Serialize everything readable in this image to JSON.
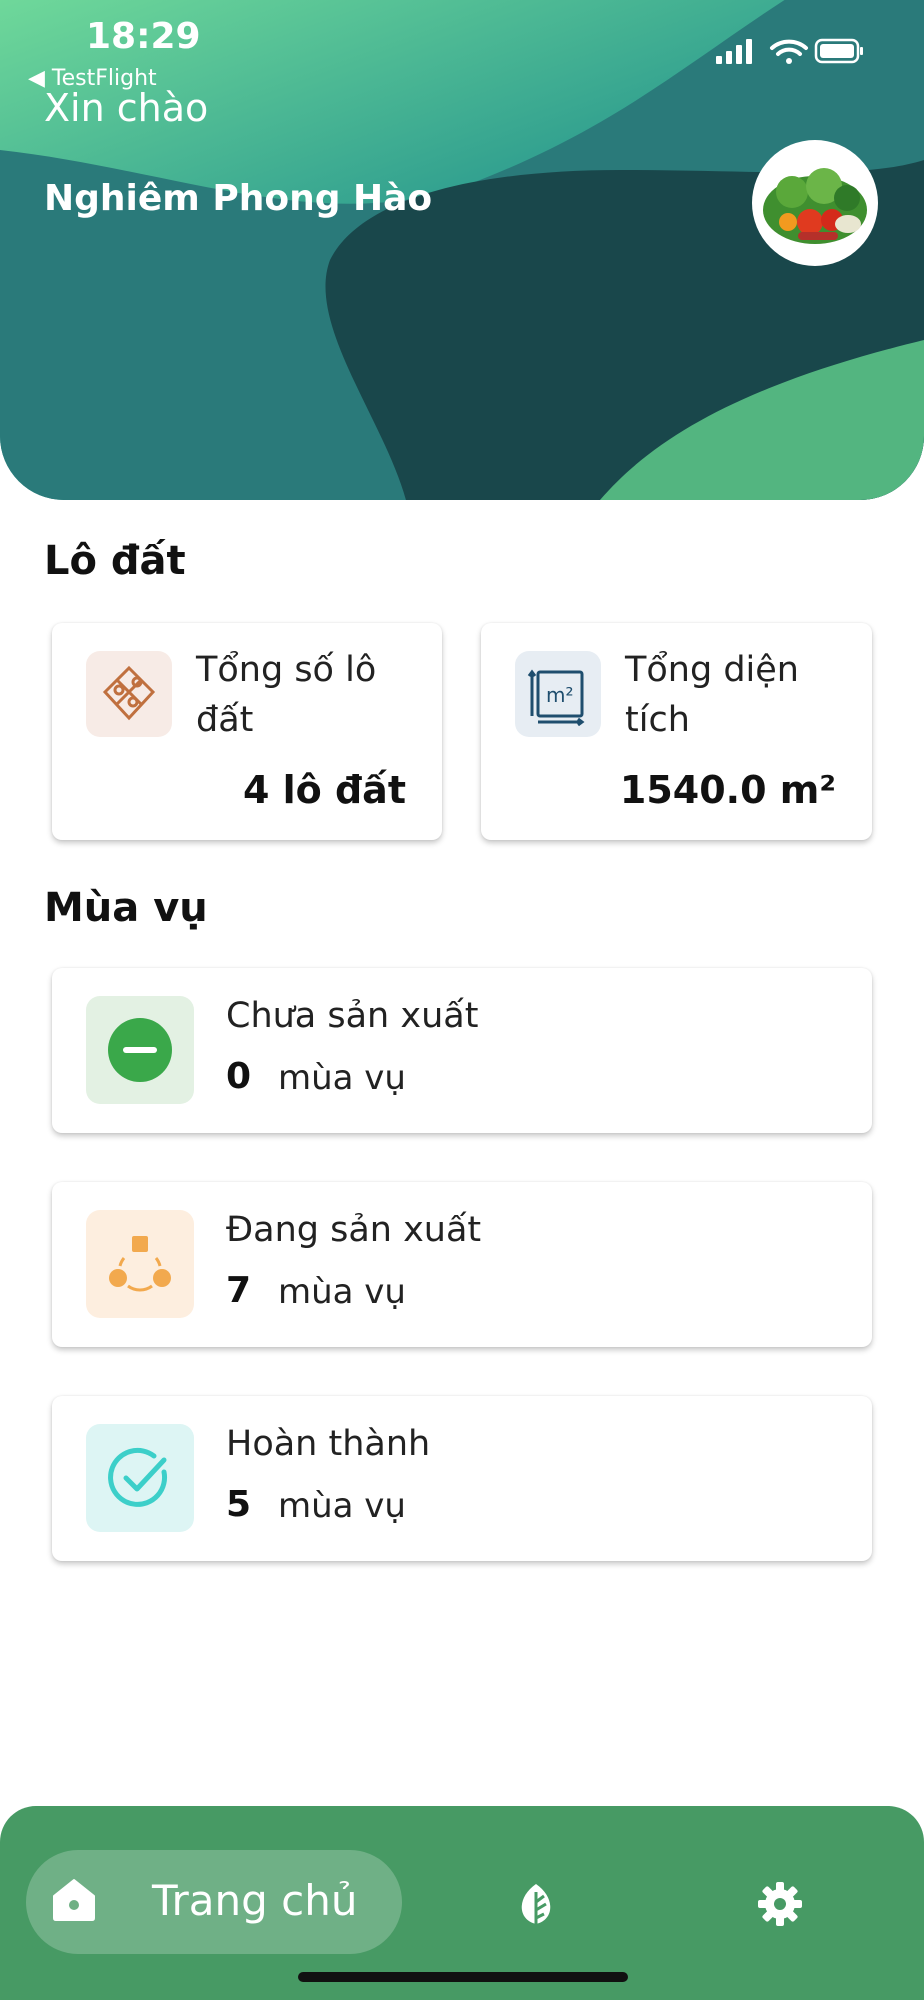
{
  "status_bar": {
    "time": "18:29",
    "back_app": "TestFlight"
  },
  "header": {
    "greeting": "Xin chào",
    "user_name": "Nghiêm Phong Hào",
    "avatar_icon": "vegetables-avatar"
  },
  "plots_section": {
    "title": "Lô đất",
    "cards": [
      {
        "label": "Tổng số lô đất",
        "value": "4 lô đất",
        "icon": "map-plot-icon",
        "icon_bg": "#f7ebe6"
      },
      {
        "label": "Tổng diện tích",
        "value": "1540.0 m²",
        "icon": "area-m2-icon",
        "icon_bg": "#e7edf3"
      }
    ]
  },
  "seasons_section": {
    "title": "Mùa vụ",
    "items": [
      {
        "label": "Chưa sản xuất",
        "count": "0",
        "unit": "mùa vụ",
        "icon": "minus-circle-icon",
        "icon_bg": "#e3f1e3"
      },
      {
        "label": "Đang sản xuất",
        "count": "7",
        "unit": "mùa vụ",
        "icon": "in-progress-icon",
        "icon_bg": "#fdeedf"
      },
      {
        "label": "Hoàn thành",
        "count": "5",
        "unit": "mùa vụ",
        "icon": "check-circle-icon",
        "icon_bg": "#ddf5f4"
      }
    ]
  },
  "bottom_nav": {
    "home_label": "Trang chủ",
    "items": [
      "home-icon",
      "leaf-icon",
      "gear-icon"
    ],
    "bg_color": "#479a64"
  }
}
